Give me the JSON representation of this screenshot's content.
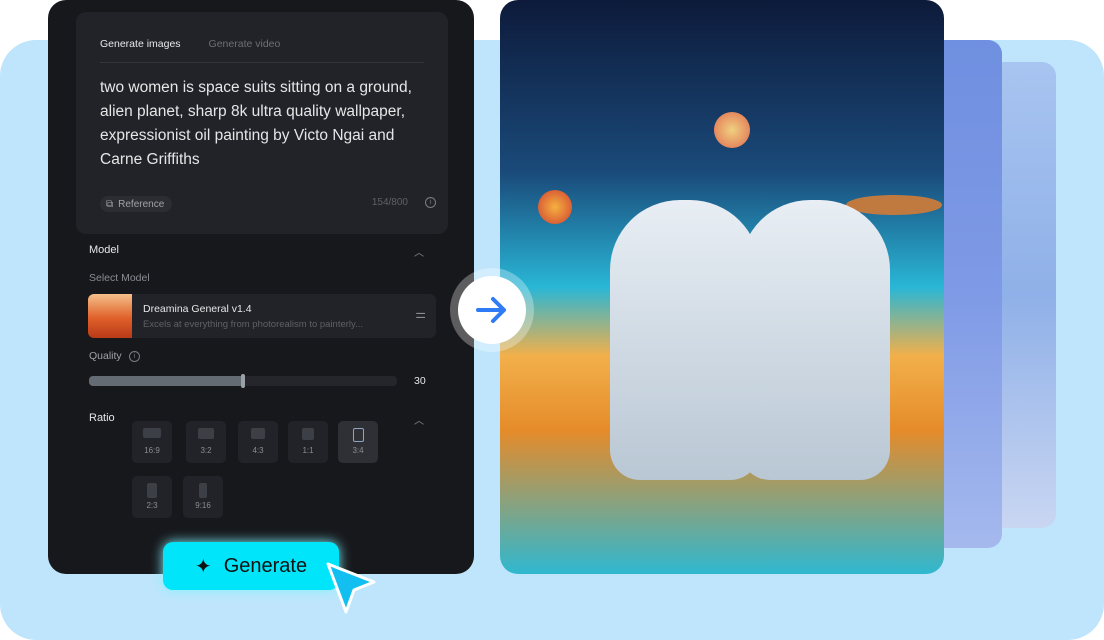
{
  "tabs": [
    "Generate images",
    "Generate video"
  ],
  "prompt": "two women is space suits sitting on a ground, alien planet, sharp 8k ultra quality wallpaper, expressionist oil painting by Victo Ngai and Carne Griffiths",
  "reference_label": "Reference",
  "char_count": "154/800",
  "model": {
    "section": "Model",
    "select_label": "Select Model",
    "name": "Dreamina General v1.4",
    "description": "Excels at everything from photorealism to painterly..."
  },
  "quality": {
    "label": "Quality",
    "value": "30",
    "fraction": 0.5
  },
  "ratio": {
    "label": "Ratio",
    "options": [
      "16:9",
      "3:2",
      "4:3",
      "1:1",
      "3:4",
      "2:3",
      "9:16"
    ],
    "selected": "3:4"
  },
  "generate_label": "Generate",
  "colors": {
    "accent": "#00e5fa",
    "panel": "#17181c",
    "background": "#bfe5fc"
  }
}
